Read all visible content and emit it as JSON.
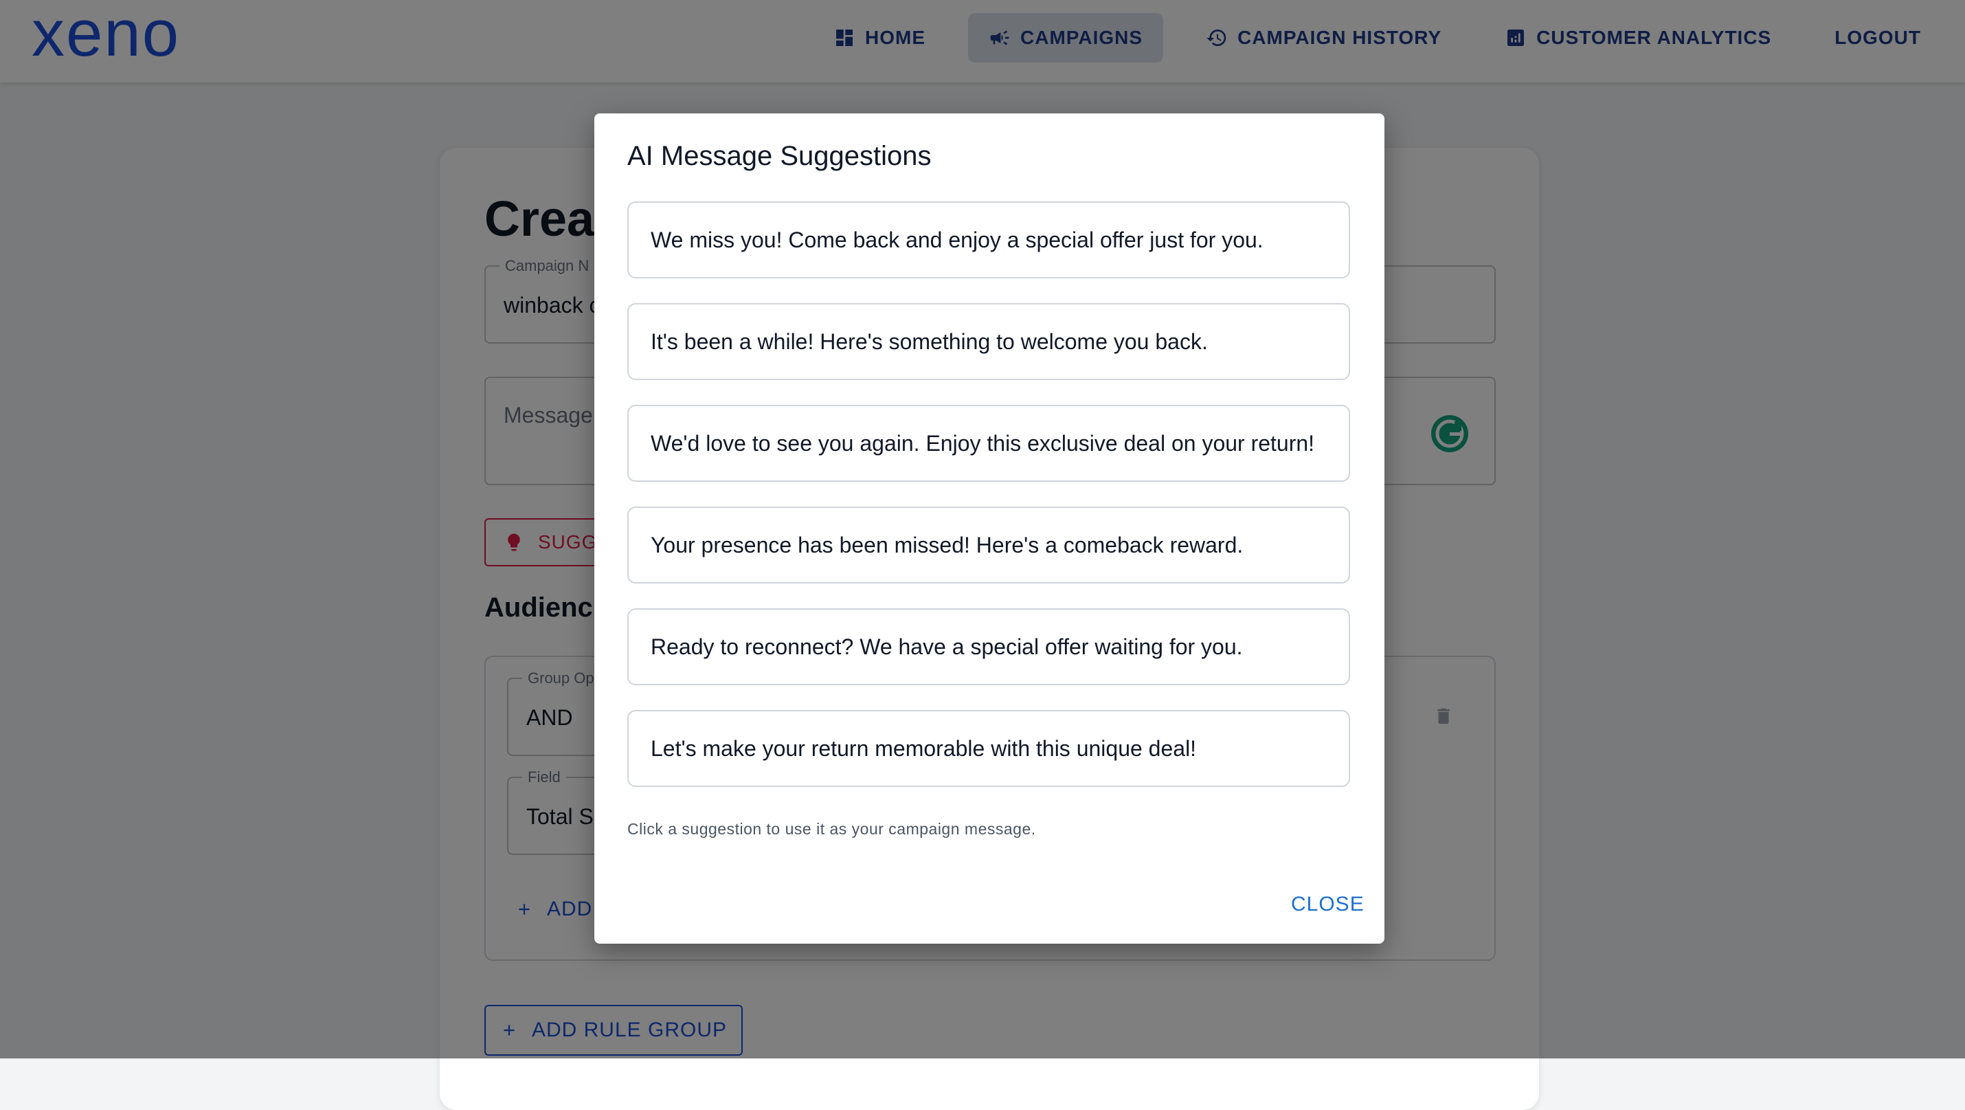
{
  "app": {
    "logo": "xeno"
  },
  "nav": {
    "items": [
      {
        "label": "HOME",
        "icon": "dashboard-icon",
        "active": false
      },
      {
        "label": "CAMPAIGNS",
        "icon": "megaphone-icon",
        "active": true
      },
      {
        "label": "CAMPAIGN HISTORY",
        "icon": "history-icon",
        "active": false
      },
      {
        "label": "CUSTOMER ANALYTICS",
        "icon": "analytics-icon",
        "active": false
      },
      {
        "label": "LOGOUT",
        "icon": "",
        "active": false
      }
    ]
  },
  "form": {
    "heading": "Creat",
    "campaign_name_label": "Campaign N",
    "campaign_name_value": "winback c",
    "message_placeholder": "Message",
    "suggest_label": "SUGG",
    "audience_title": "Audienc",
    "group_operator_label": "Group Op",
    "group_operator_value": "AND",
    "field_label": "Field",
    "field_value": "Total S",
    "add_rule_label": "ADD",
    "add_rule_group_label": "ADD RULE GROUP"
  },
  "dialog": {
    "title": "AI Message Suggestions",
    "suggestions": [
      "We miss you! Come back and enjoy a special offer just for you.",
      "It's been a while! Here's something to welcome you back.",
      "We'd love to see you again. Enjoy this exclusive deal on your return!",
      "Your presence has been missed! Here's a comeback reward.",
      "Ready to reconnect? We have a special offer waiting for you.",
      "Let's make your return memorable with this unique deal!"
    ],
    "hint": "Click a suggestion to use it as your campaign message.",
    "close_label": "CLOSE"
  },
  "colors": {
    "brand": "#1d4ed8",
    "nav_text": "#1e3a8a",
    "suggest_accent": "#e11d48",
    "dialog_action": "#1d6fd0"
  }
}
